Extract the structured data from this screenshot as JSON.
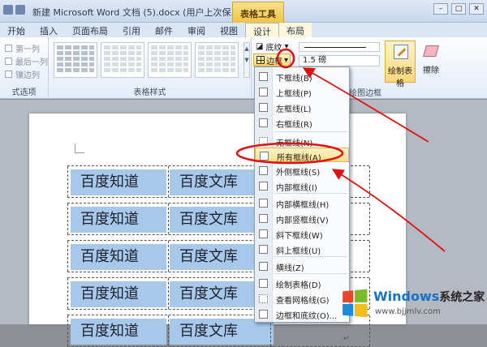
{
  "window": {
    "title": "新建 Microsoft Word 文档 (5).docx (用户上次保...",
    "context_tab": "表格工具",
    "controls": [
      "–",
      "□",
      "✕"
    ]
  },
  "tabs": [
    "开始",
    "插入",
    "页面布局",
    "引用",
    "邮件",
    "审阅",
    "视图",
    "设计",
    "布局"
  ],
  "active_tab": "设计",
  "ribbon": {
    "options": [
      "第一列",
      "最后一列",
      "镶边列"
    ],
    "options_group": "式选项",
    "styles_group": "表格样式",
    "shade_label": "底纹",
    "border_label": "边框",
    "line_weight": "1.5 磅",
    "draw_table": "绘制表格",
    "eraser": "擦除",
    "draw_borders_group": "绘图边框"
  },
  "menu": {
    "items": [
      {
        "label": "下框线(B)",
        "icon": "bottom-border-icon"
      },
      {
        "label": "上框线(P)",
        "icon": "top-border-icon"
      },
      {
        "label": "左框线(L)",
        "icon": "left-border-icon"
      },
      {
        "label": "右框线(R)",
        "icon": "right-border-icon"
      },
      {
        "label": "无框线(N)",
        "icon": "no-border-icon"
      },
      {
        "label": "所有框线(A)",
        "icon": "all-borders-icon"
      },
      {
        "label": "外侧框线(S)",
        "icon": "outside-borders-icon"
      },
      {
        "label": "内部框线(I)",
        "icon": "inside-borders-icon"
      },
      {
        "label": "内部横框线(H)",
        "icon": "inside-horizontal-border-icon"
      },
      {
        "label": "内部竖框线(V)",
        "icon": "inside-vertical-border-icon"
      },
      {
        "label": "斜下框线(W)",
        "icon": "diagonal-down-border-icon"
      },
      {
        "label": "斜上框线(U)",
        "icon": "diagonal-up-border-icon"
      },
      {
        "label": "横线(Z)",
        "icon": "horizontal-line-icon"
      },
      {
        "label": "绘制表格(D)",
        "icon": "draw-table-icon"
      },
      {
        "label": "查看网格线(G)",
        "icon": "view-gridlines-icon"
      },
      {
        "label": "边框和底纹(O)...",
        "icon": "borders-shading-icon"
      }
    ],
    "highlighted": "所有框线(A)"
  },
  "document": {
    "rows": [
      [
        "百度知道",
        "百度文库"
      ],
      [
        "百度知道",
        "百度文库"
      ],
      [
        "百度知道",
        "百度文库"
      ],
      [
        "百度知道",
        "百度文库"
      ],
      [
        "百度知道",
        "百度文库"
      ]
    ],
    "paragraph_mark": "↵"
  },
  "watermark": {
    "brand": "Windows",
    "brand_suffix": "系统之家",
    "url": "www.bjjmlv.com"
  },
  "colors": {
    "cell_fill": "#a8c8ea",
    "annotation_red": "#e01010",
    "context_tab": "#f0c44a"
  }
}
